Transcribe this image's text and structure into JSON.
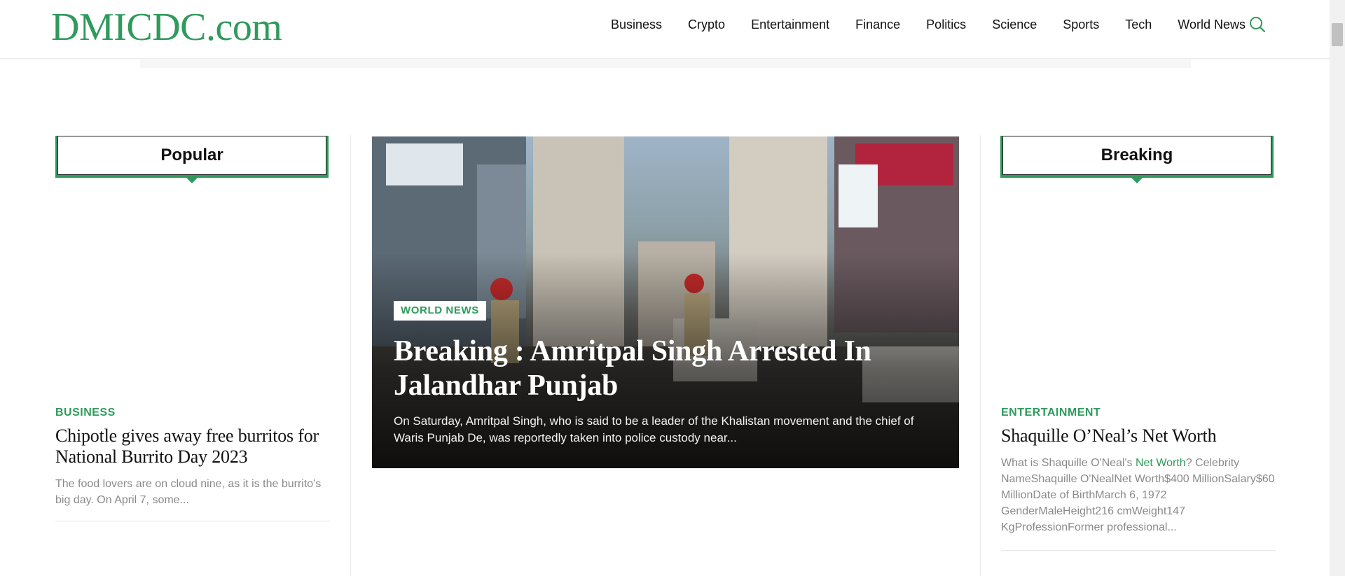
{
  "site": {
    "logo": "DMICDC.com",
    "brand_color": "#2f9a5c"
  },
  "nav": {
    "items": [
      "Business",
      "Crypto",
      "Entertainment",
      "Finance",
      "Politics",
      "Science",
      "Sports",
      "Tech",
      "World News"
    ],
    "search_icon": "search-icon"
  },
  "popular": {
    "heading": "Popular",
    "article": {
      "category": "BUSINESS",
      "title": "Chipotle gives away free burritos for National Burrito Day 2023",
      "excerpt": "The food lovers are on cloud nine, as it is the burrito's big day. On April 7, some..."
    }
  },
  "featured": {
    "category": "WORLD NEWS",
    "title": "Breaking : Amritpal Singh Arrested In Jalandhar Punjab",
    "excerpt": "On Saturday, Amritpal Singh, who is said to be a leader of the Khalistan movement and the chief of Waris Punjab De, was reportedly taken into police custody near..."
  },
  "breaking": {
    "heading": "Breaking",
    "article": {
      "category": "ENTERTAINMENT",
      "title": "Shaquille O’Neal’s Net Worth",
      "excerpt_before": "What is Shaquille O'Neal's ",
      "excerpt_link": "Net Worth",
      "excerpt_after": "? Celebrity NameShaquille O'NealNet Worth$400 MillionSalary$60 MillionDate of BirthMarch 6, 1972 GenderMaleHeight216 cmWeight147 KgProfessionFormer professional..."
    }
  }
}
